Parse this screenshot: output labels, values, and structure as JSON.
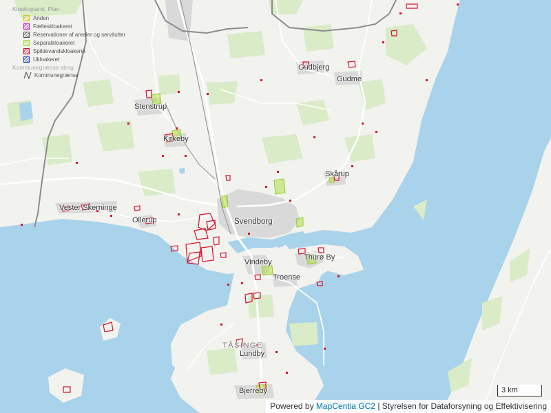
{
  "legend": {
    "title": "Kloakopland, Plan",
    "items": [
      {
        "label": "Anden",
        "color": "#c8c81e"
      },
      {
        "label": "Fælleskloakeret",
        "color": "#c81ec8"
      },
      {
        "label": "Reservationer af arealer og servitutter",
        "color": "#555555"
      },
      {
        "label": "Separatkloakeret",
        "color": "#aade3c"
      },
      {
        "label": "Spildevandskloakeret",
        "color": "#d2142d"
      },
      {
        "label": "Ukloakeret",
        "color": "#1e3cc8"
      }
    ],
    "kommune_title": "Kommunegrænse streg",
    "kommune_label": "Kommunegrænse"
  },
  "places": {
    "gudbjerg": "Gudbjerg",
    "gudme": "Gudme",
    "stenstrup": "Stenstrup",
    "kirkeby": "Kirkeby",
    "skarup": "Skårup",
    "vester_skerninge": "Vester Skerninge",
    "ollerup": "Ollerup",
    "svendborg": "Svendborg",
    "vindeby": "Vindeby",
    "thuro_by": "Thurø By",
    "troense": "Troense",
    "tasinge": "TÅSINGE",
    "lundby": "Lundby",
    "bjerreby": "Bjerreby"
  },
  "scale": {
    "label": "3 km"
  },
  "attribution": {
    "prefix": "Powered by",
    "link": "MapCentia GC2",
    "suffix": "| Styrelsen for Dataforsyning og Effektivisering"
  },
  "colors": {
    "water": "#a9d3ea",
    "land": "#f2f2ef",
    "green": "#d9ebc7",
    "urban": "#d9d9d9",
    "road": "#ffffff",
    "border": "#8c8c8c",
    "separat": "#aade3c",
    "spildevand": "#d2142d"
  }
}
